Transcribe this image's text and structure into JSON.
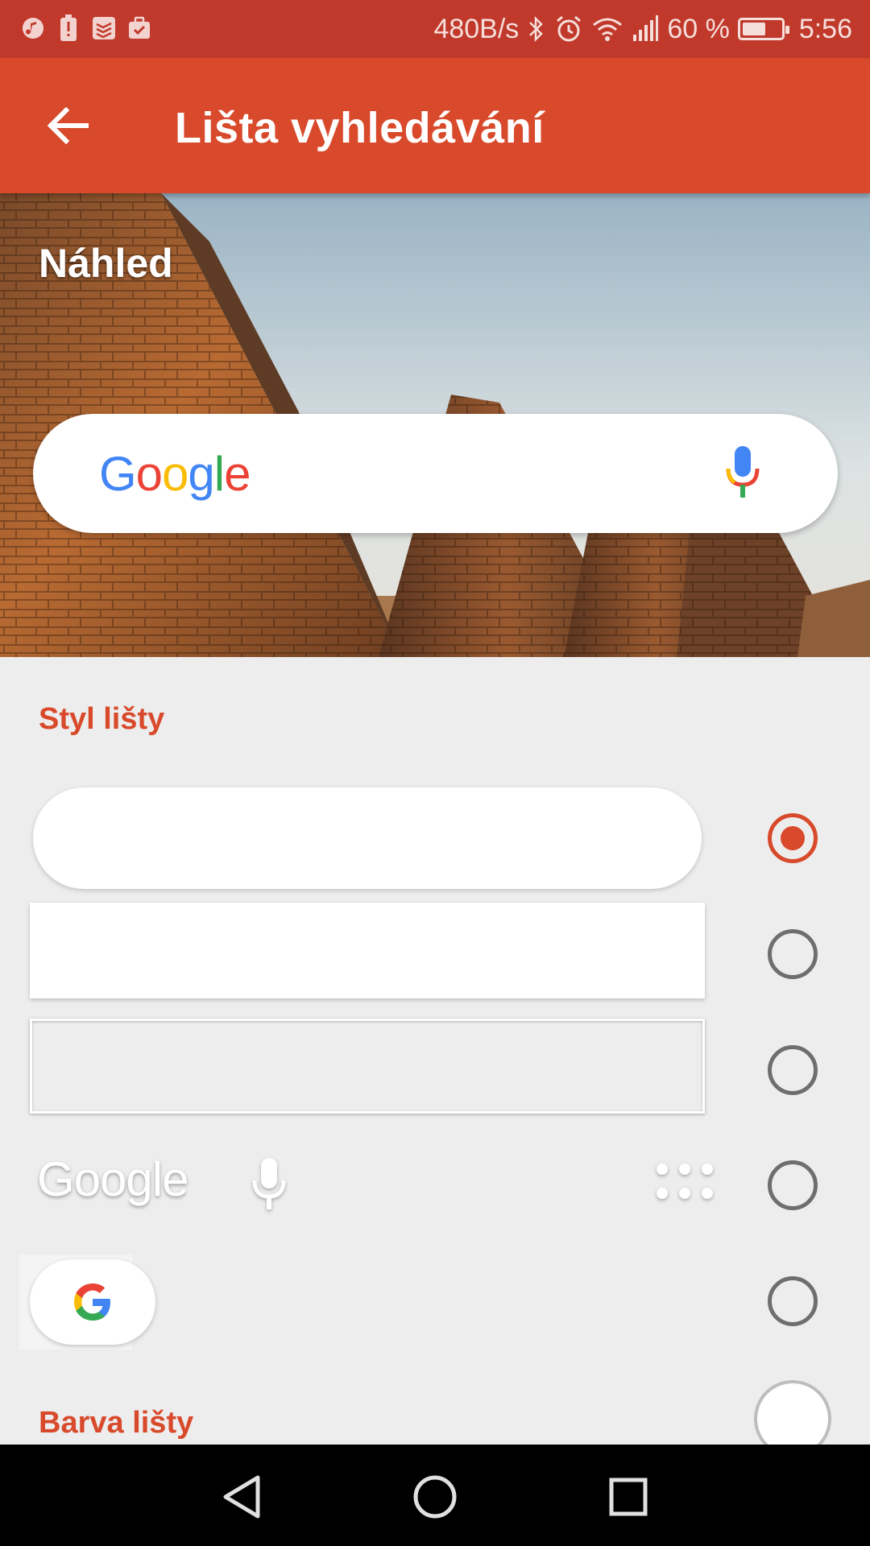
{
  "status_bar": {
    "net_speed": "480B/s",
    "battery_percent": "60 %",
    "battery_level": 0.6,
    "time": "5:56",
    "left_icons": [
      "music-icon",
      "battery-alert-icon",
      "todoist-icon",
      "work-check-icon"
    ],
    "right_icons": [
      "bluetooth-icon",
      "alarm-icon",
      "wifi-icon",
      "signal-icon",
      "battery-icon"
    ]
  },
  "app_bar": {
    "title": "Lišta vyhledávání",
    "back_icon": "arrow-back-icon"
  },
  "preview": {
    "label": "Náhled",
    "search_logo": "Google",
    "mic_icon": "mic-icon"
  },
  "style_section": {
    "title": "Styl lišty",
    "options": [
      {
        "name": "pill",
        "selected": true
      },
      {
        "name": "rectangle",
        "selected": false
      },
      {
        "name": "outline",
        "selected": false
      },
      {
        "name": "text-only",
        "selected": false,
        "logo": "Google"
      },
      {
        "name": "g-chip",
        "selected": false,
        "logo": "G"
      }
    ]
  },
  "color_section": {
    "title": "Barva lišty",
    "selected_color": "#ffffff"
  },
  "colors": {
    "status_bar": "#c0392b",
    "app_bar": "#d84a2b",
    "accent": "#d84a2b",
    "background": "#ededed",
    "google_blue": "#4285F4",
    "google_red": "#EA4335",
    "google_yellow": "#FBBC05",
    "google_green": "#34A853"
  },
  "nav_bar": {
    "back": "triangle-back-icon",
    "home": "circle-home-icon",
    "recents": "square-recents-icon"
  }
}
